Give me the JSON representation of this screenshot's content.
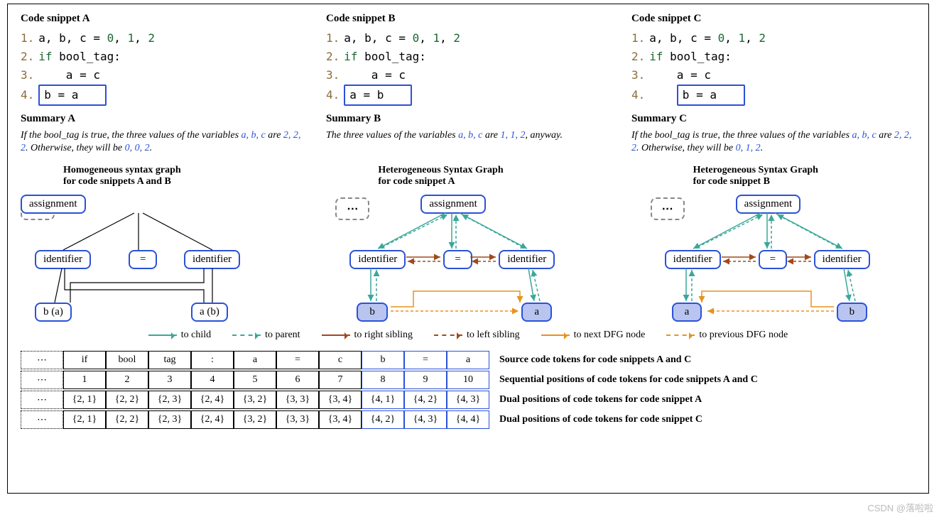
{
  "snippets": {
    "A": {
      "title": "Code snippet A",
      "lines": [
        {
          "n": "1.",
          "code_html": "a, b, c = 0, 1, 2",
          "nums": [
            0,
            1,
            2
          ]
        },
        {
          "n": "2.",
          "code_html": "if bool_tag:"
        },
        {
          "n": "3.",
          "code_html": "a = c",
          "indent": true
        },
        {
          "n": "4.",
          "boxed": "b = a"
        }
      ],
      "summaryTitle": "Summary A",
      "summary_parts": [
        "If the bool_tag is true, the three values of the variables ",
        "a, b, c",
        " are ",
        "2, 2, 2",
        ". Otherwise, they will be ",
        "0, 0, 2",
        "."
      ]
    },
    "B": {
      "title": "Code snippet B",
      "lines": [
        {
          "n": "1.",
          "code_html": "a, b, c = 0, 1, 2",
          "nums": [
            0,
            1,
            2
          ]
        },
        {
          "n": "2.",
          "code_html": "if bool_tag:"
        },
        {
          "n": "3.",
          "code_html": "a = c",
          "indent": true
        },
        {
          "n": "4.",
          "boxed": "a = b"
        }
      ],
      "summaryTitle": "Summary B",
      "summary_parts": [
        "The three values of the variables ",
        "a, b, c",
        " are ",
        "1, 1, 2",
        ", anyway."
      ]
    },
    "C": {
      "title": "Code snippet C",
      "lines": [
        {
          "n": "1.",
          "code_html": "a, b, c = 0, 1, 2",
          "nums": [
            0,
            1,
            2
          ]
        },
        {
          "n": "2.",
          "code_html": "if bool_tag:"
        },
        {
          "n": "3.",
          "code_html": "a = c",
          "indent": true
        },
        {
          "n": "4.",
          "boxed": "b = a",
          "boxindent": true
        }
      ],
      "summaryTitle": "Summary C",
      "summary_parts": [
        "If the bool_tag is true, the three values of the variables ",
        "a, b, c",
        " are ",
        "2, 2, 2",
        ". Otherwise, they will be ",
        "0, 1, 2",
        "."
      ]
    }
  },
  "graphs": {
    "homo": {
      "title": "Homogeneous syntax graph\nfor code snippets A and B",
      "root": "assignment",
      "mids": [
        "identifier",
        "=",
        "identifier"
      ],
      "leaves": [
        "b (a)",
        "a (b)"
      ],
      "shade": false
    },
    "hetA": {
      "title": "Heterogeneous Syntax Graph\nfor code snippet A",
      "root": "assignment",
      "mids": [
        "identifier",
        "=",
        "identifier"
      ],
      "leaves": [
        "b",
        "a"
      ],
      "shade": true
    },
    "hetB": {
      "title": "Heterogeneous Syntax Graph\nfor code snippet B",
      "root": "assignment",
      "mids": [
        "identifier",
        "=",
        "identifier"
      ],
      "leaves": [
        "a",
        "b"
      ],
      "shade": true
    }
  },
  "legend": [
    {
      "color": "teal",
      "dashed": false,
      "label": "to child"
    },
    {
      "color": "teal",
      "dashed": true,
      "label": "to parent"
    },
    {
      "color": "brown",
      "dashed": false,
      "label": "to right sibling"
    },
    {
      "color": "brown",
      "dashed": true,
      "label": "to left sibling"
    },
    {
      "color": "orange",
      "dashed": false,
      "label": "to next DFG node"
    },
    {
      "color": "orange",
      "dashed": true,
      "label": "to previous DFG node"
    }
  ],
  "tables": {
    "tokens": {
      "label": "Source code tokens for code snippets A and C",
      "cells": [
        "if",
        "bool",
        "tag",
        ":",
        "a",
        "=",
        "c",
        "b",
        "=",
        "a"
      ],
      "blueStart": 7
    },
    "seq": {
      "label": "Sequential positions of code tokens for code snippets A and C",
      "cells": [
        "1",
        "2",
        "3",
        "4",
        "5",
        "6",
        "7",
        "8",
        "9",
        "10"
      ],
      "blueStart": 7
    },
    "dualA": {
      "label": "Dual positions of code tokens for code snippet A",
      "cells": [
        "{2, 1}",
        "{2, 2}",
        "{2, 3}",
        "{2, 4}",
        "{3, 2}",
        "{3, 3}",
        "{3, 4}",
        "{4, 1}",
        "{4, 2}",
        "{4, 3}"
      ],
      "blueStart": 7
    },
    "dualC": {
      "label": "Dual positions of code tokens for code snippet C",
      "cells": [
        "{2, 1}",
        "{2, 2}",
        "{2, 3}",
        "{2, 4}",
        "{3, 2}",
        "{3, 3}",
        "{3, 4}",
        "{4, 2}",
        "{4, 3}",
        "{4, 4}"
      ],
      "blueStart": 7
    }
  },
  "watermark": "CSDN @落啦啦"
}
